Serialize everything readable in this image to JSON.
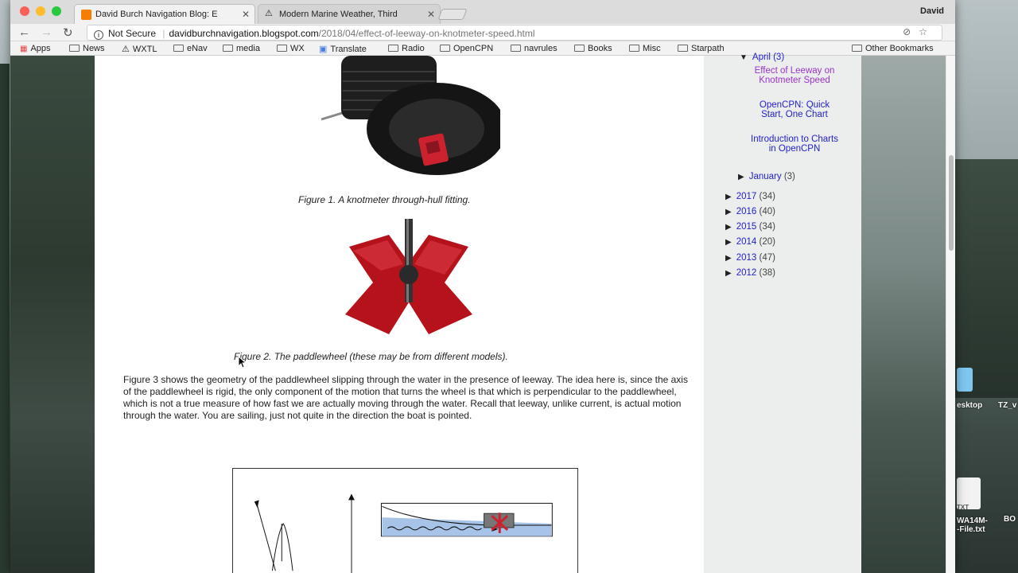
{
  "browser": {
    "user": "David",
    "tabs": [
      {
        "title": "David Burch Navigation Blog: E",
        "active": true
      },
      {
        "title": "Modern Marine Weather, Third",
        "active": false
      }
    ],
    "security": "Not Secure",
    "url_host": "davidburchnavigation.blogspot.com",
    "url_path": "/2018/04/effect-of-leeway-on-knotmeter-speed.html",
    "bookmarks": [
      "Apps",
      "News",
      "WXTL",
      "eNav",
      "media",
      "WX",
      "Translate",
      "Radio",
      "OpenCPN",
      "navrules",
      "Books",
      "Misc",
      "Starpath"
    ],
    "other_bookmarks": "Other Bookmarks"
  },
  "article": {
    "figure1_caption": "Figure 1. A knotmeter through-hull fitting.",
    "figure2_caption": "Figure 2.  The paddlewheel (these may be from different models).",
    "paragraph": "Figure 3 shows the geometry of the paddlewheel slipping through the water in the presence of leeway. The idea here is, since the axis of the paddlewheel is rigid, the only component of the motion that turns the wheel is that which is perpendicular to the paddlewheel, which is not a true measure of how fast we are actually moving through the water.  Recall that leeway, unlike current, is actual motion through the water. You are sailing, just not quite in the direction the boat is pointed."
  },
  "sidebar": {
    "current_month": "April (3)",
    "posts": [
      {
        "title": "Effect of Leeway on Knotmeter Speed",
        "visited": true
      },
      {
        "title": "OpenCPN: Quick Start, One Chart",
        "visited": false
      },
      {
        "title": "Introduction to Charts in OpenCPN",
        "visited": false
      }
    ],
    "january": {
      "label": "January",
      "count": "(3)"
    },
    "years": [
      {
        "year": "2017",
        "count": "(34)"
      },
      {
        "year": "2016",
        "count": "(40)"
      },
      {
        "year": "2015",
        "count": "(34)"
      },
      {
        "year": "2014",
        "count": "(20)"
      },
      {
        "year": "2013",
        "count": "(47)"
      },
      {
        "year": "2012",
        "count": "(38)"
      }
    ]
  },
  "desktop": {
    "labels": [
      "esktop",
      "TZ_v",
      "WA14M-",
      "-File.txt",
      "BO",
      "TXT"
    ]
  },
  "colors": {
    "link": "#2222cc",
    "visited": "#9933cc",
    "red_fitting": "#cc2230"
  }
}
